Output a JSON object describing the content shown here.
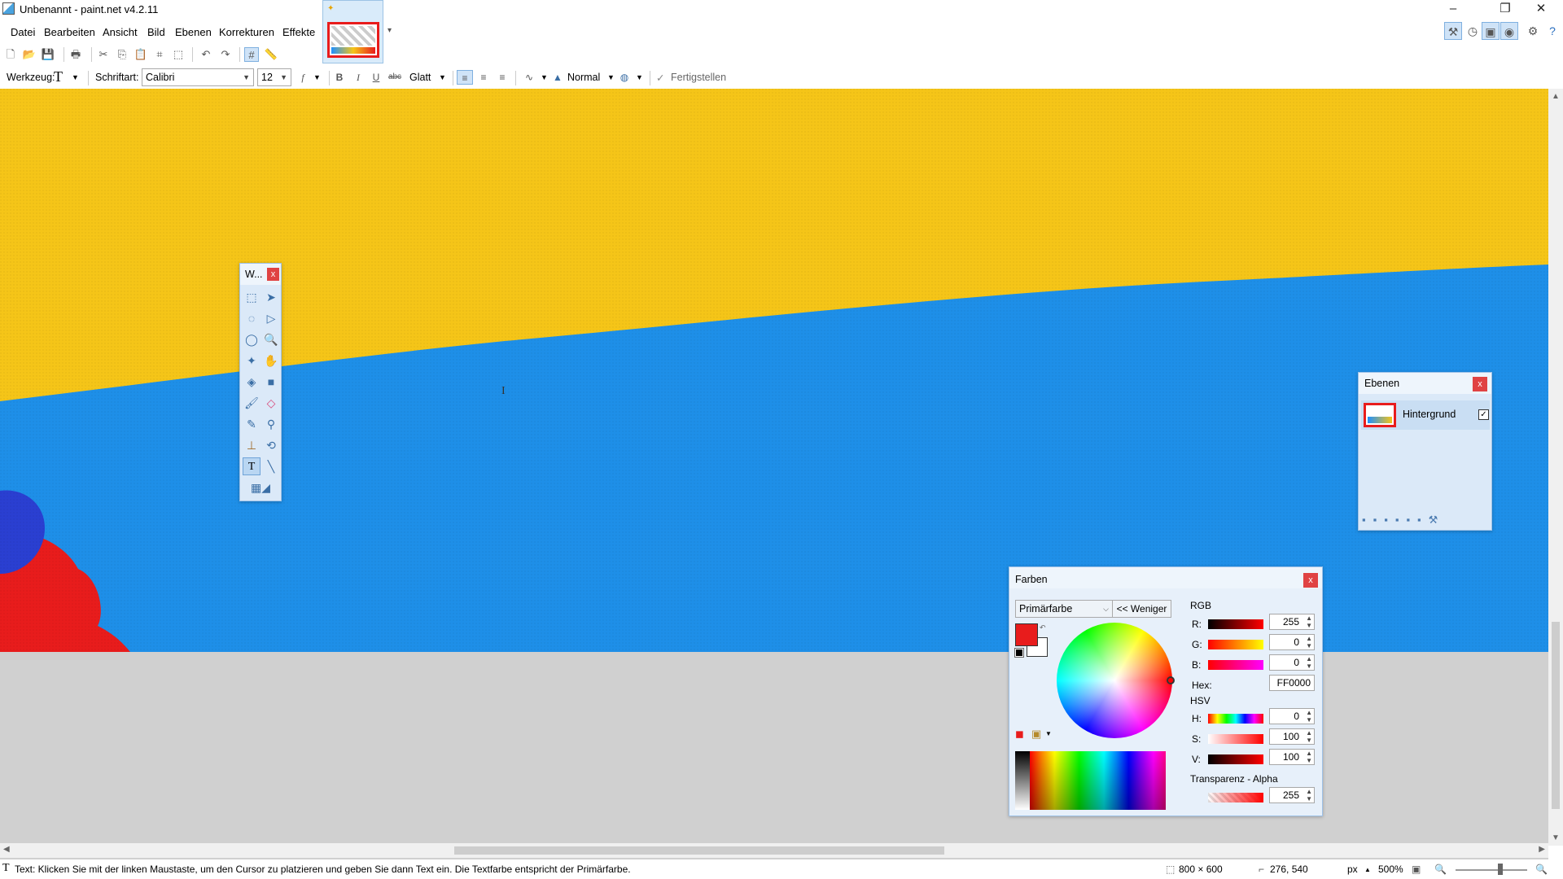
{
  "window": {
    "title": "Unbenannt - paint.net v4.2.11"
  },
  "menu": [
    "Datei",
    "Bearbeiten",
    "Ansicht",
    "Bild",
    "Ebenen",
    "Korrekturen",
    "Effekte"
  ],
  "toolbar": {
    "tool_label": "Werkzeug:",
    "font_label": "Schriftart:",
    "font_value": "Calibri",
    "size_value": "12",
    "rendering_value": "Glatt",
    "blend_value": "Normal",
    "finish_label": "Fertigstellen"
  },
  "tools_window": {
    "title": "W...",
    "close": "x"
  },
  "layers_window": {
    "title": "Ebenen",
    "close": "x",
    "layer_name": "Hintergrund"
  },
  "colors_window": {
    "title": "Farben",
    "close": "x",
    "mode": "Primärfarbe",
    "less_button": "<< Weniger",
    "rgb_label": "RGB",
    "r_label": "R:",
    "r_value": "255",
    "g_label": "G:",
    "g_value": "0",
    "b_label": "B:",
    "b_value": "0",
    "hex_label": "Hex:",
    "hex_value": "FF0000",
    "hsv_label": "HSV",
    "h_label": "H:",
    "h_value": "0",
    "s_label": "S:",
    "s_value": "100",
    "v_label": "V:",
    "v_value": "100",
    "alpha_label": "Transparenz - Alpha",
    "alpha_value": "255",
    "primary_color": "#e81c1c"
  },
  "status": {
    "message": "Text: Klicken Sie mit der linken Maustaste, um den Cursor zu platzieren und geben Sie dann Text ein. Die Textfarbe entspricht der Primärfarbe.",
    "image_size": "800 × 600",
    "cursor_pos": "276, 540",
    "unit": "px",
    "zoom": "500%"
  },
  "colors": {
    "accent": "#3a6ea5",
    "canvas_yellow": "#f5c518",
    "canvas_blue": "#1e8fe8",
    "canvas_red": "#e81c1c"
  }
}
